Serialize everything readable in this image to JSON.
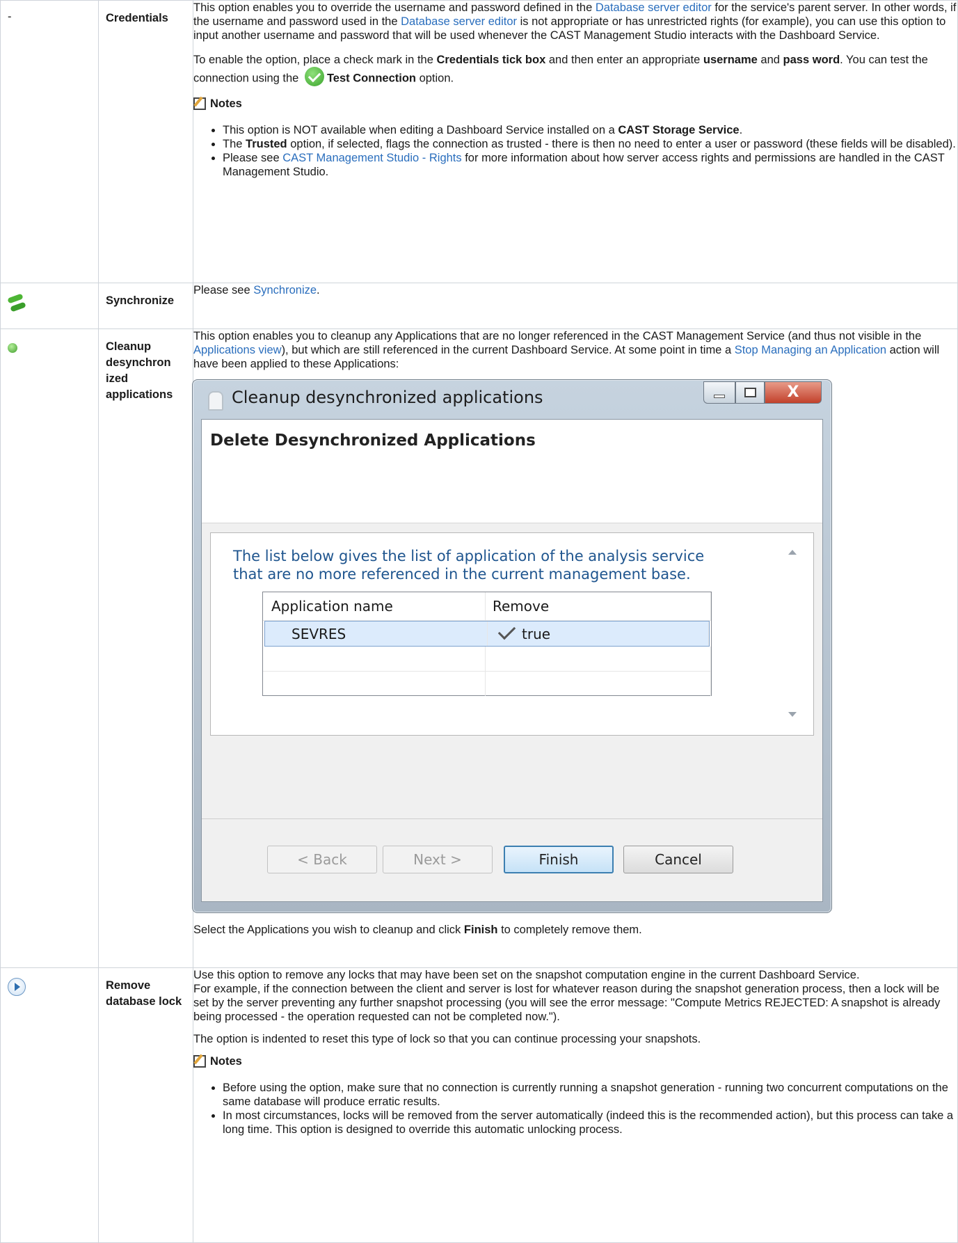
{
  "rows": [
    {
      "icon": "dash",
      "icon_text": "-",
      "name": "Credentials",
      "p1": [
        "This option enables you to override the username and password defined in the ",
        "Database server editor",
        " for the service's parent server. In other words, if the username and password used in the ",
        "Database server editor",
        " is not appropriate or has unrestricted rights (for example), you can use this option to input another username and password that will be used whenever the CAST Management Studio interacts with the Dashboard Service."
      ],
      "p2": [
        "To enable the option, place a check mark in the ",
        "Credentials tick box",
        " and then enter an appropriate ",
        "username",
        " and ",
        "pass word",
        ". You can test the connection using the ",
        "Test Connection",
        " option."
      ],
      "notes_title": "Notes",
      "notes": [
        [
          "This option is NOT available when editing a Dashboard Service installed on a ",
          "CAST Storage Service",
          "."
        ],
        [
          "The ",
          "Trusted",
          " option, if selected, flags the connection as trusted - there is then no need to enter a user or password (these fields will be disabled)."
        ],
        [
          "Please see ",
          "CAST Management Studio - Rights",
          " for more information about how server access rights and permissions are handled in the CAST Management Studio."
        ]
      ]
    },
    {
      "icon": "sync-icon",
      "name": "Synchronize",
      "text": [
        "Please see ",
        "Synchronize",
        "."
      ]
    },
    {
      "icon": "cleanup-icon",
      "name": "Cleanup desynchron ized applications",
      "p1": [
        "This option enables you to cleanup any Applications that are no longer referenced in the CAST Management Service (and thus not visible in the ",
        "Applications view",
        "), but which are still referenced in the current Dashboard Service. At some point in time a ",
        "Stop Managing an Application",
        " action will have been applied to these Applications:"
      ],
      "dialog": {
        "title": "Cleanup desynchronized applications",
        "heading": "Delete Desynchronized Applications",
        "message": "The list below gives the list of application of the analysis service that are no more referenced in the current management base.",
        "columns": [
          "Application name",
          "Remove"
        ],
        "rows": [
          [
            "SEVRES",
            "true"
          ]
        ],
        "buttons": {
          "back": "< Back",
          "next": "Next >",
          "finish": "Finish",
          "cancel": "Cancel"
        },
        "close_glyph": "X"
      },
      "p2": [
        "Select the Applications you wish to cleanup and click ",
        "Finish",
        " to completely remove them."
      ]
    },
    {
      "icon": "play-icon",
      "name": "Remove database lock",
      "p1": "Use this option to remove any locks that may have been set on the snapshot computation engine in the current Dashboard Service.",
      "p1b": "For example, if the connection between the client and server is lost for whatever reason during the snapshot generation process, then a lock will be set by the server preventing any further snapshot processing (you will see the error message: \"Compute Metrics REJECTED: A snapshot is already being processed - the operation requested can not be completed now.\").",
      "p2": "The option is indented to reset this type of lock so that you can continue processing your snapshots.",
      "notes_title": "Notes",
      "notes": [
        "Before using the option, make sure that no connection is currently running a snapshot generation - running two concurrent computations on the same database will produce erratic results.",
        "In most circumstances, locks will be removed from the server automatically (indeed this is the recommended action), but this process can take a long time. This option is designed to override this automatic unlocking process."
      ]
    }
  ]
}
